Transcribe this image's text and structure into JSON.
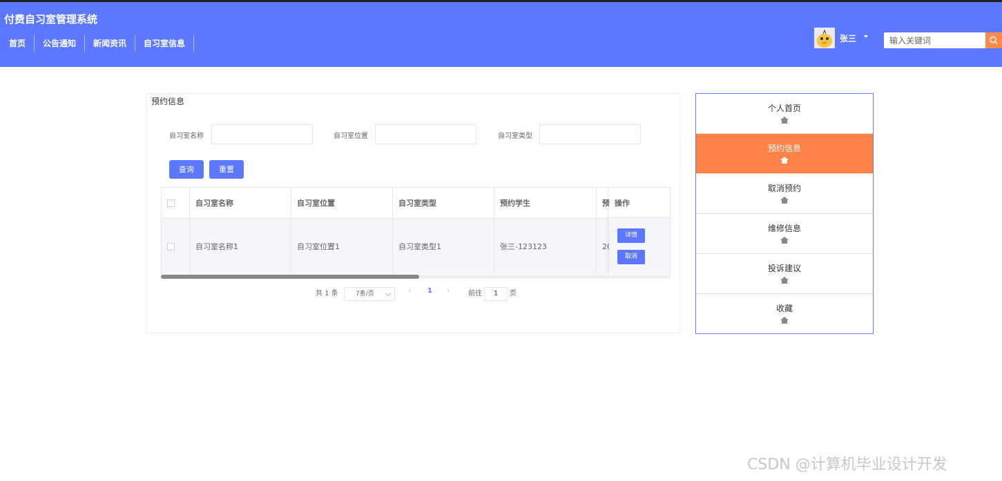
{
  "header": {
    "title": "付费自习室管理系统",
    "nav": [
      "首页",
      "公告通知",
      "新闻资讯",
      "自习室信息"
    ],
    "user": {
      "name": "张三"
    },
    "search": {
      "placeholder": "输入关键词"
    }
  },
  "panel": {
    "title": "预约信息",
    "filters": [
      {
        "label": "自习室名称",
        "value": ""
      },
      {
        "label": "自习室位置",
        "value": ""
      },
      {
        "label": "自习室类型",
        "value": ""
      }
    ],
    "buttons": {
      "query": "查询",
      "reset": "重置"
    },
    "table": {
      "columns": [
        "自习室名称",
        "自习室位置",
        "自习室类型",
        "预约学生",
        "预",
        "操作"
      ],
      "rows": [
        {
          "name": "自习室名称1",
          "location": "自习室位置1",
          "type": "自习室类型1",
          "student": "张三-123123",
          "time": "20"
        }
      ],
      "row_actions": {
        "detail": "详情",
        "cancel": "取消"
      }
    },
    "pagination": {
      "total": "共 1 条",
      "page_size": "7条/页",
      "current": "1",
      "goto_label": "前往",
      "goto_value": "1",
      "page_unit": "页"
    }
  },
  "sidebar": {
    "items": [
      {
        "label": "个人首页",
        "icon": "home-icon"
      },
      {
        "label": "预约信息",
        "icon": "home-icon",
        "active": true
      },
      {
        "label": "取消预约",
        "icon": "home-icon"
      },
      {
        "label": "维修信息",
        "icon": "home-icon"
      },
      {
        "label": "投诉建议",
        "icon": "home-icon"
      },
      {
        "label": "收藏",
        "icon": "home-icon"
      }
    ]
  },
  "watermark": "CSDN @计算机毕业设计开发",
  "colors": {
    "primary": "#5b78ff",
    "accent": "#ff8247"
  }
}
